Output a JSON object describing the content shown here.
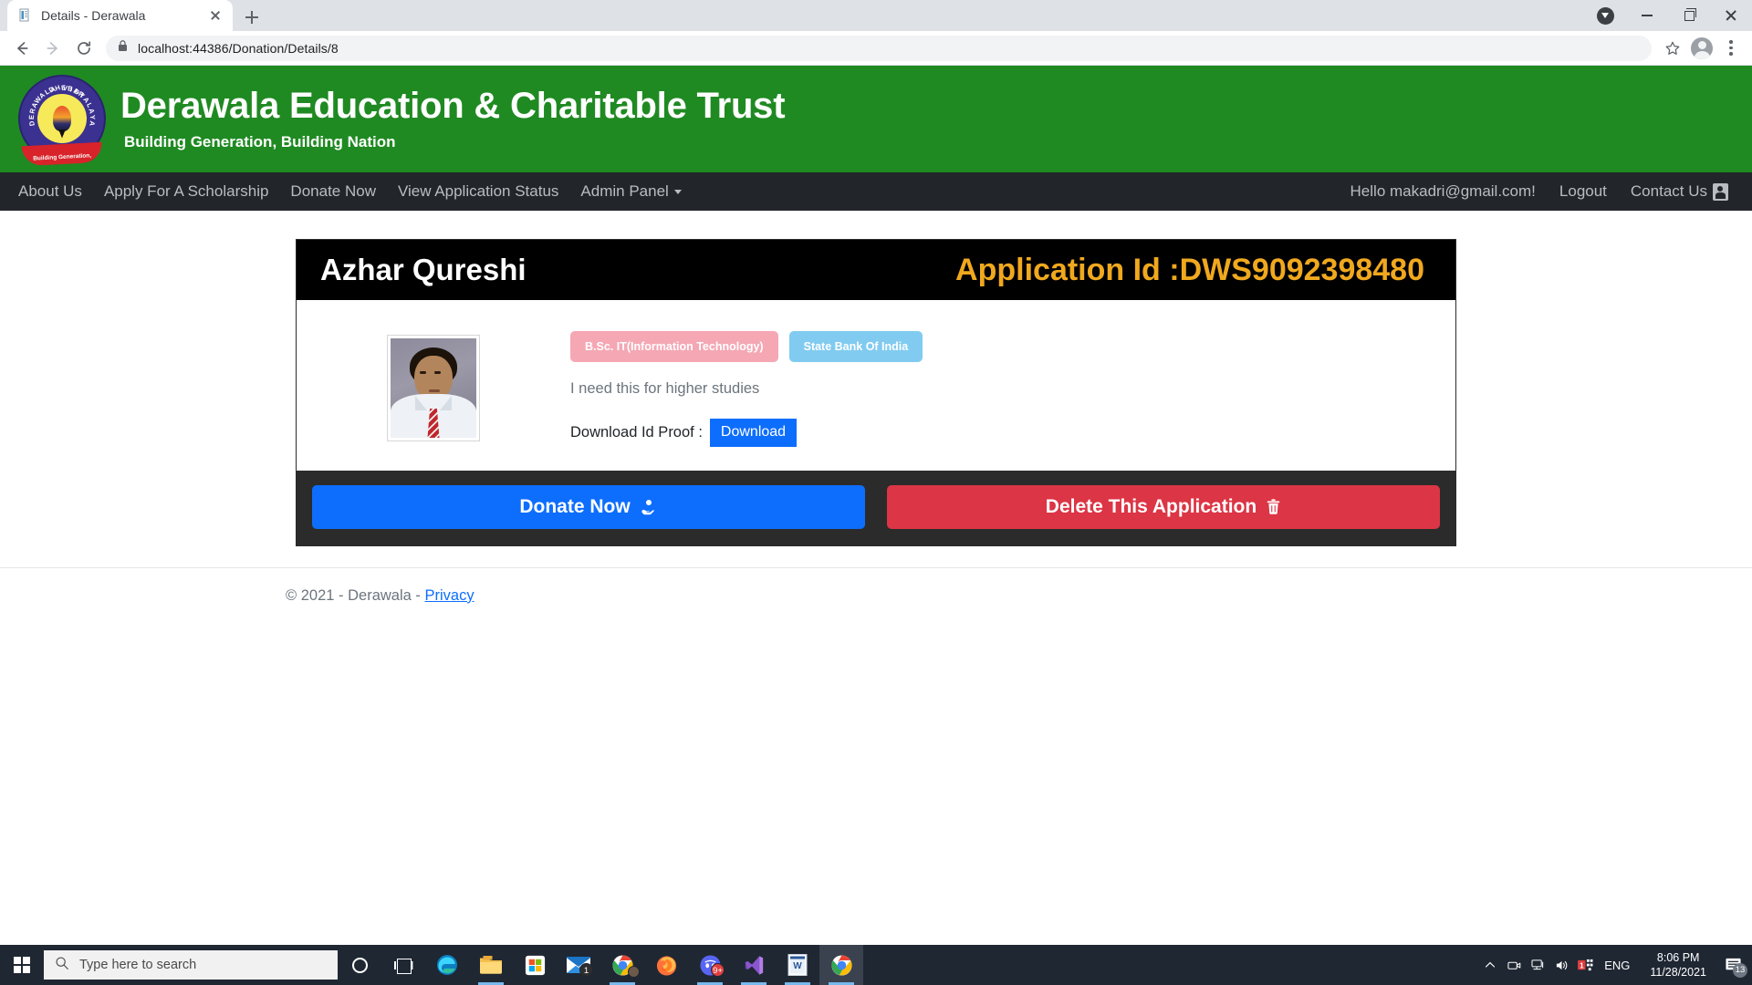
{
  "browser": {
    "tab": {
      "title": "Details - Derawala",
      "favicon_icon": "page-icon",
      "close_icon": "close-icon"
    },
    "new_tab_icon": "plus-icon",
    "back_icon": "back-arrow-icon",
    "forward_icon": "forward-arrow-icon",
    "reload_icon": "reload-icon",
    "lock_icon": "lock-icon",
    "url": "localhost:44386/Donation/Details/8",
    "bookmark_icon": "star-icon",
    "profile_icon": "profile-avatar-icon",
    "menu_icon": "three-dot-menu-icon",
    "download_update_icon": "download-circle-icon",
    "minimize_icon": "minimize-icon",
    "maximize_icon": "maximize-icon",
    "close_window_icon": "close-window-icon"
  },
  "site": {
    "title": "Derawala Education & Charitable Trust",
    "tagline": "Building Generation, Building Nation",
    "logo": {
      "top_text": "DERAWALA VIDYALAYA",
      "bottom_text": "DHEBAR",
      "ribbon_text": "Building Generation, Building Nation"
    },
    "header_color": "#1f8a22"
  },
  "nav": {
    "left_items": [
      {
        "label": "About Us",
        "name": "nav-about-us"
      },
      {
        "label": "Apply For A Scholarship",
        "name": "nav-apply-scholarship"
      },
      {
        "label": "Donate Now",
        "name": "nav-donate-now"
      },
      {
        "label": "View Application Status",
        "name": "nav-view-application-status"
      },
      {
        "label": "Admin Panel",
        "name": "nav-admin-panel",
        "has_caret": true
      }
    ],
    "greeting": "Hello makadri@gmail.com!",
    "logout": "Logout",
    "contact": "Contact Us",
    "contact_icon": "contact-card-icon"
  },
  "card": {
    "applicant_name": "Azhar Qureshi",
    "application_id_label": "Application Id :DWS9092398480",
    "application_id_color": "#f0a81e",
    "photo_alt": "applicant-photo",
    "badges": [
      {
        "label": "B.Sc. IT(Information Technology)",
        "color": "#f5a7b4",
        "name": "course-badge"
      },
      {
        "label": "State Bank Of India",
        "color": "#81cbf0",
        "name": "bank-badge"
      }
    ],
    "reason": "I need this for higher studies",
    "download_label": "Download Id Proof :",
    "download_button": "Download",
    "donate_button": "Donate Now",
    "donate_icon": "hand-holding-coin-icon",
    "delete_button": "Delete This Application",
    "delete_icon": "trash-icon",
    "donate_color": "#0d6efd",
    "delete_color": "#dc3545"
  },
  "footer": {
    "copyright": "© 2021 - Derawala - ",
    "privacy_link": "Privacy"
  },
  "taskbar": {
    "start_icon": "windows-start-icon",
    "search_placeholder": "Type here to search",
    "search_icon": "search-icon",
    "cortana_icon": "cortana-icon",
    "taskview_icon": "task-view-icon",
    "apps": [
      {
        "name": "taskbar-app-edge",
        "icon": "edge-icon",
        "running": false,
        "badge": ""
      },
      {
        "name": "taskbar-app-file-explorer",
        "icon": "file-explorer-icon",
        "running": true,
        "badge": ""
      },
      {
        "name": "taskbar-app-microsoft-store",
        "icon": "microsoft-store-icon",
        "running": false,
        "badge": ""
      },
      {
        "name": "taskbar-app-mail",
        "icon": "mail-icon",
        "running": false,
        "badge": "1"
      },
      {
        "name": "taskbar-app-chrome-profile",
        "icon": "chrome-icon",
        "running": true,
        "badge": ""
      },
      {
        "name": "taskbar-app-firefox",
        "icon": "firefox-icon",
        "running": false,
        "badge": ""
      },
      {
        "name": "taskbar-app-discord",
        "icon": "discord-icon",
        "running": true,
        "badge": "9+"
      },
      {
        "name": "taskbar-app-visual-studio",
        "icon": "visual-studio-icon",
        "running": true,
        "badge": ""
      },
      {
        "name": "taskbar-app-word",
        "icon": "word-icon",
        "running": true,
        "badge": ""
      },
      {
        "name": "taskbar-app-chrome",
        "icon": "chrome-icon",
        "running": true,
        "active": true,
        "badge": ""
      }
    ],
    "tray": {
      "chevron_icon": "chevron-up-icon",
      "camera_icon": "camera-icon",
      "network_icon": "network-icon",
      "volume_icon": "volume-icon",
      "ime_icon": "ime-icon",
      "ime_badge": "1",
      "language": "ENG",
      "time": "8:06 PM",
      "date": "11/28/2021",
      "notification_icon": "notification-icon",
      "notification_count": "13"
    }
  }
}
